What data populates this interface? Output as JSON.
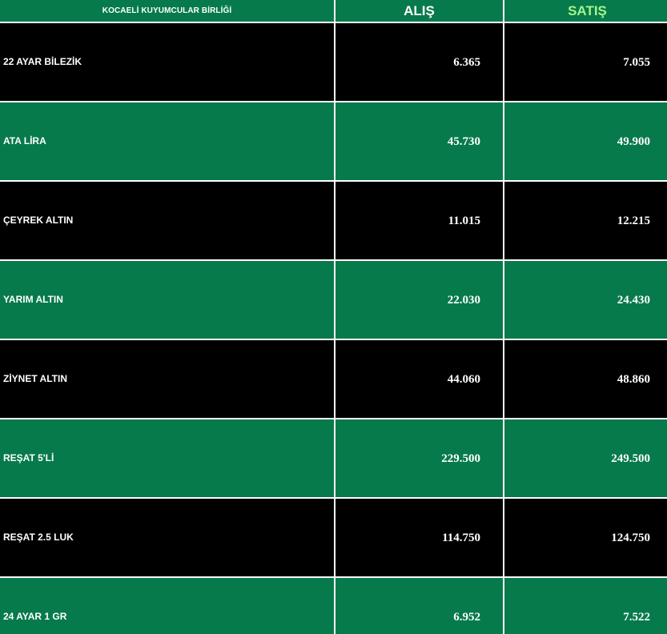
{
  "header": {
    "title": "KOCAELİ KUYUMCULAR BİRLİĞİ",
    "buy_label": "ALIŞ",
    "sell_label": "SATIŞ"
  },
  "colors": {
    "green": "#067a4b",
    "dark": "#000000",
    "sell_header": "#a5f58a",
    "text": "#ffffff"
  },
  "rows": [
    {
      "name": "22 AYAR BİLEZİK",
      "buy": "6.365",
      "sell": "7.055"
    },
    {
      "name": "ATA LİRA",
      "buy": "45.730",
      "sell": "49.900"
    },
    {
      "name": "ÇEYREK ALTIN",
      "buy": "11.015",
      "sell": "12.215"
    },
    {
      "name": "YARIM ALTIN",
      "buy": "22.030",
      "sell": "24.430"
    },
    {
      "name": "ZİYNET ALTIN",
      "buy": "44.060",
      "sell": "48.860"
    },
    {
      "name": "REŞAT 5'Lİ",
      "buy": "229.500",
      "sell": "249.500"
    },
    {
      "name": "REŞAT 2.5 LUK",
      "buy": "114.750",
      "sell": "124.750"
    },
    {
      "name": "24 AYAR 1 GR",
      "buy": "6.952",
      "sell": "7.522"
    }
  ]
}
